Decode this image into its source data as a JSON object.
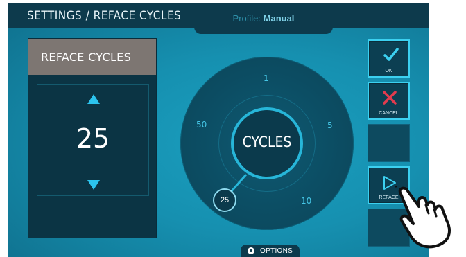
{
  "header": {
    "title": "SETTINGS / REFACE CYCLES",
    "profile_label": "Profile:",
    "profile_value": "Manual"
  },
  "left_panel": {
    "title": "REFACE CYCLES",
    "value": "25"
  },
  "dial": {
    "center_label": "CYCLES",
    "ticks": [
      "1",
      "5",
      "10",
      "50"
    ],
    "marker_value": "25"
  },
  "options": {
    "label": "OPTIONS"
  },
  "buttons": {
    "ok_label": "OK",
    "cancel_label": "CANCEL",
    "reface_label": "REFACE"
  },
  "colors": {
    "accent": "#2cc4ee",
    "cancel": "#e23b4e",
    "panel": "#0b3444"
  },
  "icons": [
    "up-arrow-icon",
    "down-arrow-icon",
    "check-icon",
    "x-icon",
    "play-icon",
    "gear-icon",
    "pointing-hand-icon"
  ]
}
